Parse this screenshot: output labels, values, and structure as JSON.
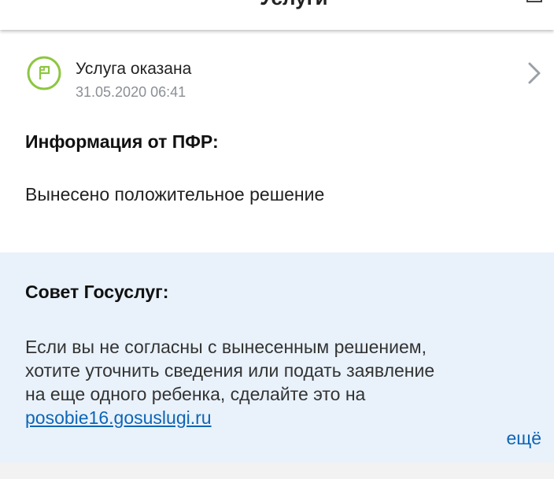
{
  "header": {
    "title": "Услуги"
  },
  "status": {
    "title": "Услуга оказана",
    "date": "31.05.2020 06:41",
    "icon": "flag-icon",
    "accent_color": "#8dc63f"
  },
  "info": {
    "heading": "Информация от ПФР:",
    "text": "Вынесено положительное решение"
  },
  "advice": {
    "heading": "Совет Госуслуг:",
    "lines": [
      "Если вы не согласны с вынесенным решением,",
      "хотите уточнить сведения или подать заявление",
      "на еще одного ребенка, сделайте это на"
    ],
    "link": "posobie16.gosuslugi.ru",
    "more": "ещё",
    "background": "#e9f2fb",
    "link_color": "#0d65b6"
  }
}
